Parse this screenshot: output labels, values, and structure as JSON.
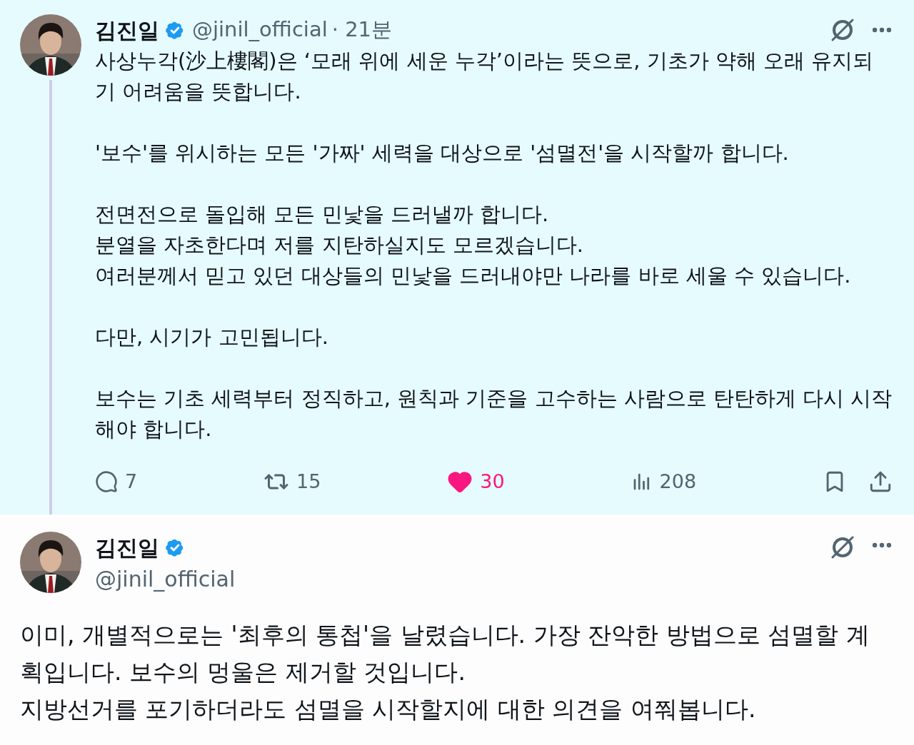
{
  "tweets": [
    {
      "author": {
        "name": "김진일",
        "verified": true,
        "handle": "@jinil_official",
        "time": "· 21분"
      },
      "highlighted": true,
      "thread_line": true,
      "body": [
        "사상누각(沙上樓閣)은 ‘모래 위에 세운 누각’이라는 뜻으로, 기초가 약해 오래 유지되기 어려움을 뜻합니다.",
        "'보수'를 위시하는 모든 '가짜' 세력을 대상으로 '섬멸전'을 시작할까 합니다.",
        "전면전으로 돌입해 모든 민낯을 드러낼까 합니다.\n분열을 자초한다며 저를 지탄하실지도 모르겠습니다.\n여러분께서 믿고 있던 대상들의 민낯을 드러내야만 나라를 바로 세울 수 있습니다.",
        "다만, 시기가 고민됩니다.",
        "보수는 기초 세력부터 정직하고, 원칙과 기준을 고수하는 사람으로 탄탄하게 다시 시작해야 합니다."
      ],
      "actions": [
        {
          "kind": "reply",
          "count": "7",
          "active": false
        },
        {
          "kind": "repost",
          "count": "15",
          "active": false
        },
        {
          "kind": "like",
          "count": "30",
          "active": true
        },
        {
          "kind": "views",
          "count": "208"
        },
        {
          "kind": "bookmark",
          "active": false
        },
        {
          "kind": "share"
        }
      ]
    },
    {
      "author": {
        "name": "김진일",
        "verified": true,
        "handle": "@jinil_official"
      },
      "highlighted": false,
      "body": [
        "이미, 개별적으로는 '최후의 통첩'을 날렸습니다. 가장 잔악한 방법으로 섬멸할 계획입니다. 보수의 멍울은 제거할 것입니다.\n지방선거를 포기하더라도 섬멸을 시작할지에 대한 의견을 여쭤봅니다."
      ]
    }
  ]
}
